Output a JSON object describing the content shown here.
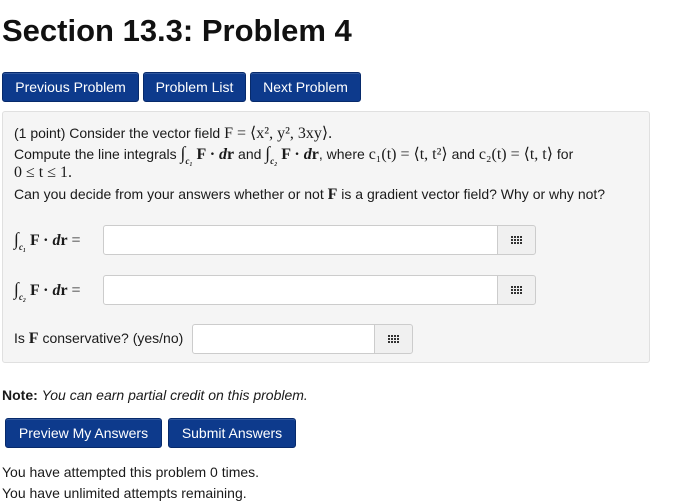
{
  "page": {
    "title": "Section 13.3: Problem 4"
  },
  "nav": {
    "prev_label": "Previous Problem",
    "list_label": "Problem List",
    "next_label": "Next Problem"
  },
  "problem": {
    "points": "(1 point)",
    "intro_text": "Consider the vector field",
    "field_def": "F = ⟨x², y², 3xy⟩.",
    "line2_a": "Compute the line integrals",
    "line2_and": "and",
    "line2_where": ", where",
    "c1_def": "c₁(t) = ⟨t, t²⟩",
    "line2_and2": "and",
    "c2_def": "c₂(t) = ⟨t, t⟩",
    "line2_for": "for",
    "range": "0 ≤ t ≤ 1.",
    "question_a": "Can you decide from your answers whether or not",
    "question_b": "is a gradient vector field? Why or why not?",
    "conservative_label_a": "Is",
    "conservative_label_b": "conservative? (yes/no)"
  },
  "answers": {
    "answer1_value": "",
    "answer2_value": "",
    "answer3_value": ""
  },
  "note": {
    "label": "Note:",
    "text": "You can earn partial credit on this problem."
  },
  "actions": {
    "preview_label": "Preview My Answers",
    "submit_label": "Submit Answers"
  },
  "status": {
    "attempts": "You have attempted this problem 0 times.",
    "remaining": "You have unlimited attempts remaining."
  },
  "colors": {
    "button_bg": "#0d3a8c",
    "panel_bg": "#f5f5f5"
  },
  "icons": {
    "answer_tool": "grid-icon"
  }
}
